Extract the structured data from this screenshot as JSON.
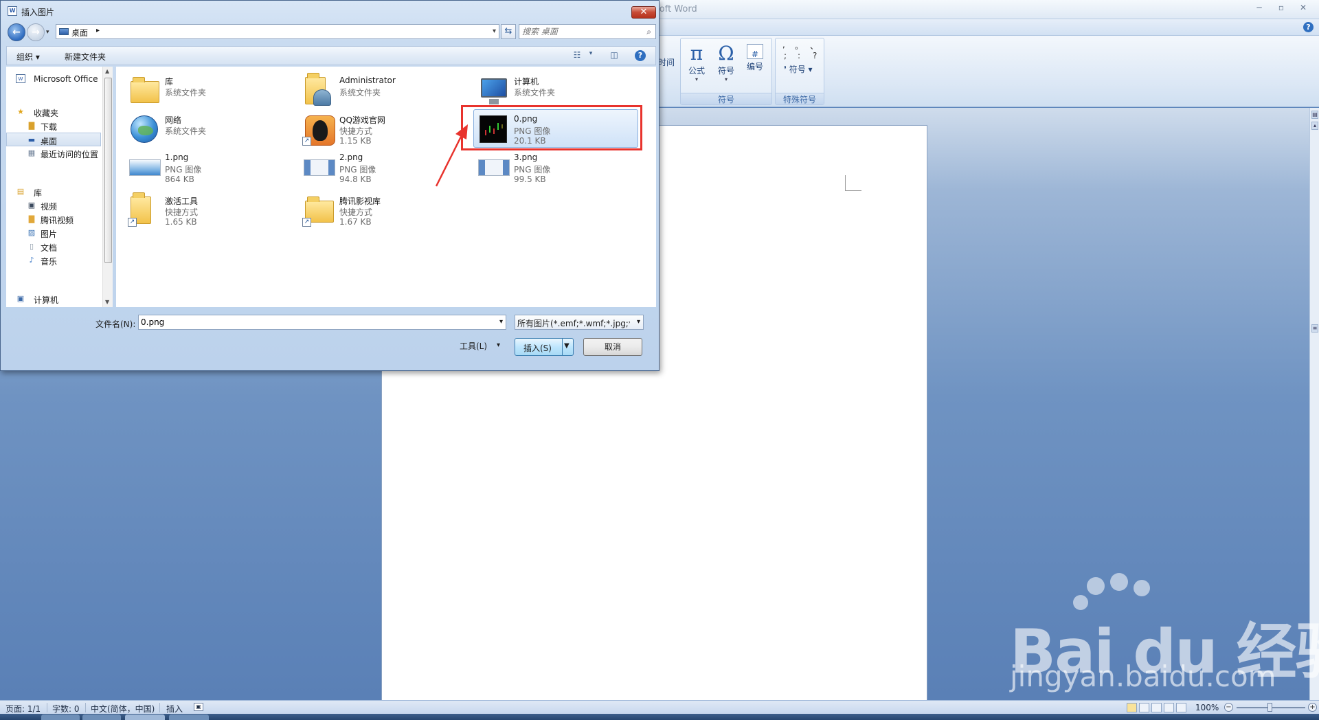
{
  "word": {
    "title": "Microsoft Word",
    "title_visible": "rosoft Word",
    "ribbon": {
      "partial_label": "时间",
      "groups": [
        {
          "name": "符号",
          "buttons": [
            {
              "label": "公式",
              "glyph": "π"
            },
            {
              "label": "符号",
              "glyph": "Ω"
            },
            {
              "label": "编号",
              "glyph": "#"
            }
          ]
        },
        {
          "name": "特殊符号",
          "buttons": [
            {
              "label": "符号"
            }
          ]
        }
      ],
      "punct": [
        ",",
        "。",
        "、",
        ";",
        ":",
        "?"
      ]
    },
    "status": {
      "page": "页面: 1/1",
      "words": "字数: 0",
      "language": "中文(简体，中国)",
      "mode": "插入",
      "zoom": "100%"
    }
  },
  "dialog": {
    "title": "插入图片",
    "close_label": "✕",
    "address": {
      "location": "桌面",
      "crumb_arrow": "▸"
    },
    "search_placeholder": "搜索 桌面",
    "toolbar": {
      "organize": "组织 ▾",
      "new_folder": "新建文件夹",
      "help": "?"
    },
    "nav_items": [
      {
        "label": "Microsoft Office",
        "icon": "office-icon"
      },
      {
        "label": "收藏夹",
        "icon": "star-icon"
      },
      {
        "label": "下载",
        "icon": "download-folder-icon"
      },
      {
        "label": "桌面",
        "icon": "desktop-icon",
        "selected": true
      },
      {
        "label": "最近访问的位置",
        "icon": "recent-icon"
      },
      {
        "label": "库",
        "icon": "library-icon"
      },
      {
        "label": "视频",
        "icon": "video-icon"
      },
      {
        "label": "腾讯视频",
        "icon": "folder-icon"
      },
      {
        "label": "图片",
        "icon": "picture-icon"
      },
      {
        "label": "文档",
        "icon": "document-icon"
      },
      {
        "label": "音乐",
        "icon": "music-icon"
      },
      {
        "label": "计算机",
        "icon": "computer-icon"
      }
    ],
    "files": [
      {
        "name": "库",
        "type": "系统文件夹",
        "size": "",
        "icon": "library-folder-icon"
      },
      {
        "name": "Administrator",
        "type": "系统文件夹",
        "size": "",
        "icon": "user-folder-icon"
      },
      {
        "name": "计算机",
        "type": "系统文件夹",
        "size": "",
        "icon": "computer-icon"
      },
      {
        "name": "网络",
        "type": "系统文件夹",
        "size": "",
        "icon": "network-globe-icon"
      },
      {
        "name": "QQ游戏官网",
        "type": "快捷方式",
        "size": "1.15 KB",
        "icon": "qq-game-icon"
      },
      {
        "name": "0.png",
        "type": "PNG 图像",
        "size": "20.1 KB",
        "icon": "png-thumbnail-icon",
        "selected": true
      },
      {
        "name": "1.png",
        "type": "PNG 图像",
        "size": "864 KB",
        "icon": "png-thumbnail-icon"
      },
      {
        "name": "2.png",
        "type": "PNG 图像",
        "size": "94.8 KB",
        "icon": "png-thumbnail-icon"
      },
      {
        "name": "3.png",
        "type": "PNG 图像",
        "size": "99.5 KB",
        "icon": "png-thumbnail-icon"
      },
      {
        "name": "激活工具",
        "type": "快捷方式",
        "size": "1.65 KB",
        "icon": "folder-shortcut-icon"
      },
      {
        "name": "腾讯影视库",
        "type": "快捷方式",
        "size": "1.67 KB",
        "icon": "folder-shortcut-icon"
      }
    ],
    "filename_label": "文件名(N):",
    "filename_value": "0.png",
    "filetype_value": "所有图片(*.emf;*.wmf;*.jpg;*.jpeg;*.jfif;*.jpe;*.png;*.bmp;*.dib;*.rle;*.gif)",
    "tools_label": "工具(L)",
    "insert_label": "插入(S)",
    "cancel_label": "取消"
  },
  "watermark": {
    "logo": "Bai du 经验",
    "url": "jingyan.baidu.com"
  },
  "colors": {
    "highlight": "#e8332d",
    "selection": "#cfe2f8",
    "accent": "#2f6fc0"
  }
}
